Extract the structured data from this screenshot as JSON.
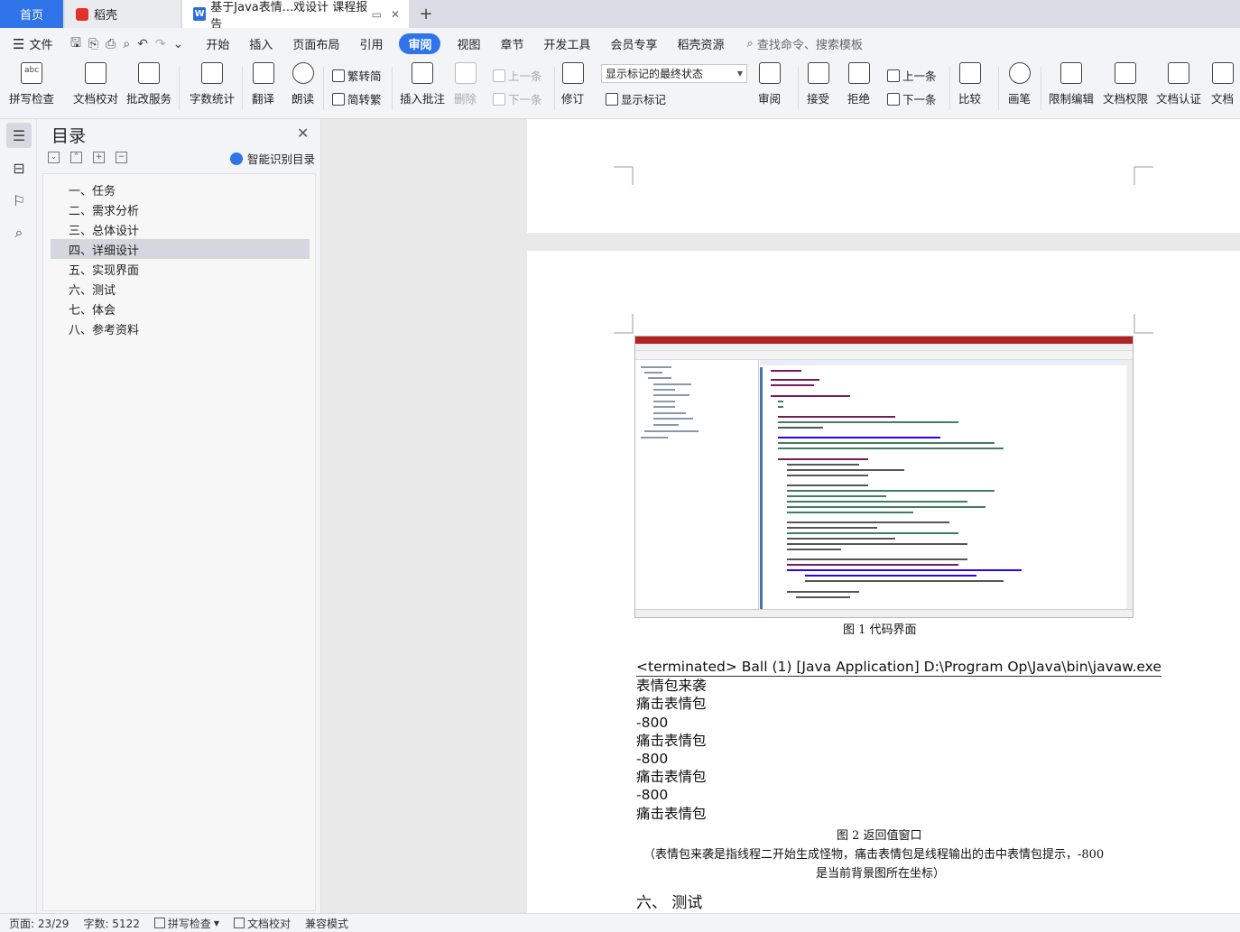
{
  "tabs": {
    "home": "首页",
    "daoke": "稻壳",
    "doc": "基于Java表情...戏设计 课程报告",
    "close": "✕",
    "new": "+"
  },
  "menu": {
    "file": "文件",
    "items": [
      "开始",
      "插入",
      "页面布局",
      "引用",
      "审阅",
      "视图",
      "章节",
      "开发工具",
      "会员专享",
      "稻壳资源"
    ],
    "active_index": 4,
    "search": "查找命令、搜索模板"
  },
  "ribbon": {
    "spell_check": "拼写检查",
    "doc_proof": "文档校对",
    "batch_service": "批改服务",
    "word_count": "字数统计",
    "translate": "翻译",
    "read_aloud": "朗读",
    "to_traditional": "繁转简",
    "to_simplified": "简转繁",
    "insert_comment": "插入批注",
    "delete": "删除",
    "prev": "上一条",
    "next": "下一条",
    "track_changes": "修订",
    "show_markup_dropdown": "显示标记的最终状态",
    "show_markup": "显示标记",
    "review": "审阅",
    "accept": "接受",
    "reject": "拒绝",
    "prev2": "上一条",
    "next2": "下一条",
    "compare": "比较",
    "pen": "画笔",
    "restrict_edit": "限制编辑",
    "doc_permission": "文档权限",
    "doc_certify": "文档认证",
    "doc_more": "文档"
  },
  "toc": {
    "title": "目录",
    "ai_button": "智能识别目录",
    "items": [
      "一、任务",
      "二、需求分析",
      "三、总体设计",
      "四、详细设计",
      "五、实现界面",
      "六、测试",
      "七、体会",
      "八、参考资料"
    ],
    "active_index": 3
  },
  "document": {
    "figure1_caption": "图 1    代码界面",
    "console_lines": [
      "<terminated> Ball (1) [Java Application] D:\\Program Op\\Java\\bin\\javaw.exe",
      "表情包来袭",
      "痛击表情包",
      "-800",
      "痛击表情包",
      "-800",
      "痛击表情包",
      "-800",
      "痛击表情包"
    ],
    "figure2_caption": "图 2    返回值窗口",
    "figure2_note_line1": "（表情包来袭是指线程二开始生成怪物，痛击表情包是线程输出的击中表情包提示，-800",
    "figure2_note_line2": "是当前背景图所在坐标）",
    "section_heading": "六、   测试"
  },
  "status": {
    "page": "页面: 23/29",
    "words": "字数: 5122",
    "spell": "拼写检查",
    "proof": "文档校对",
    "compat": "兼容模式"
  },
  "colors": {
    "accent": "#2f74e8",
    "daoke_red": "#e0312a",
    "eclipse_title": "#b22222"
  }
}
